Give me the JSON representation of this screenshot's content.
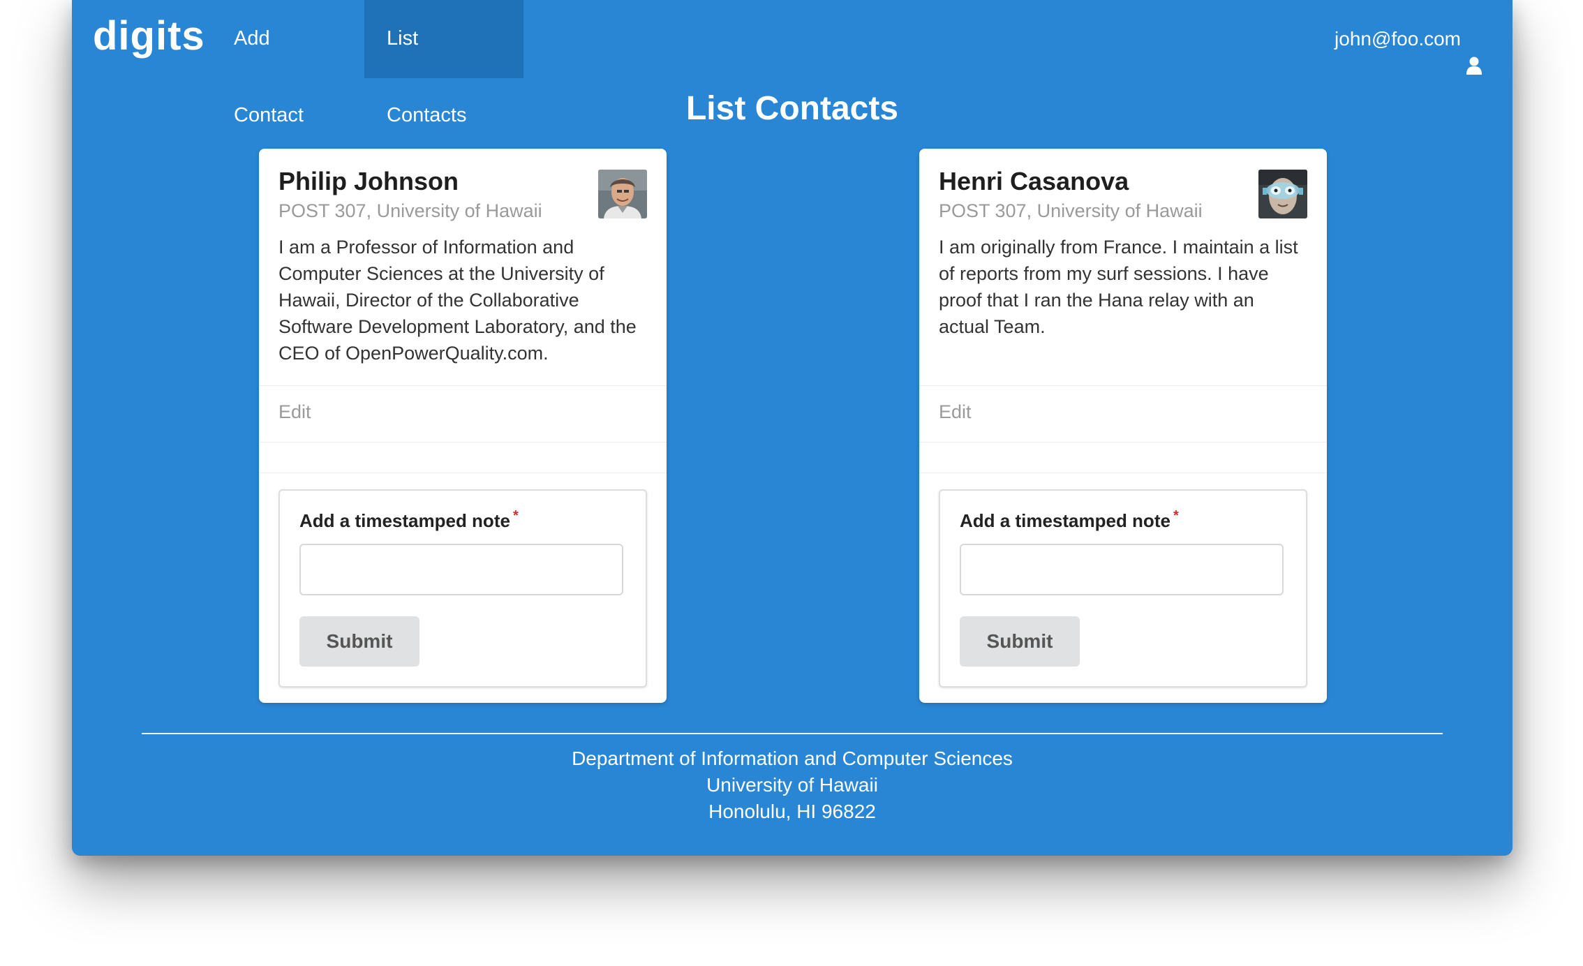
{
  "nav": {
    "brand": "digits",
    "items": [
      {
        "label": "Add Contact",
        "active": false
      },
      {
        "label": "List Contacts",
        "active": true
      }
    ],
    "user": "john@foo.com",
    "user_icon": "user-icon"
  },
  "page_title": "List Contacts",
  "contacts": [
    {
      "name": "Philip Johnson",
      "address": "POST 307, University of Hawaii",
      "description": "I am a Professor of Information and Computer Sciences at the University of Hawaii, Director of the Collaborative Software Development Laboratory, and the CEO of OpenPowerQuality.com.",
      "edit_label": "Edit",
      "note_label": "Add a timestamped note",
      "required_mark": "*",
      "note_value": "",
      "submit_label": "Submit"
    },
    {
      "name": "Henri Casanova",
      "address": "POST 307, University of Hawaii",
      "description": "I am originally from France. I maintain a list of reports from my surf sessions. I have proof that I ran the Hana relay with an actual Team.",
      "edit_label": "Edit",
      "note_label": "Add a timestamped note",
      "required_mark": "*",
      "note_value": "",
      "submit_label": "Submit"
    }
  ],
  "footer": {
    "line1": "Department of Information and Computer Sciences",
    "line2": "University of Hawaii",
    "line3": "Honolulu, HI 96822"
  },
  "colors": {
    "background": "#2886d4",
    "nav_active": "#1f72b8",
    "required": "#d22f2f"
  }
}
